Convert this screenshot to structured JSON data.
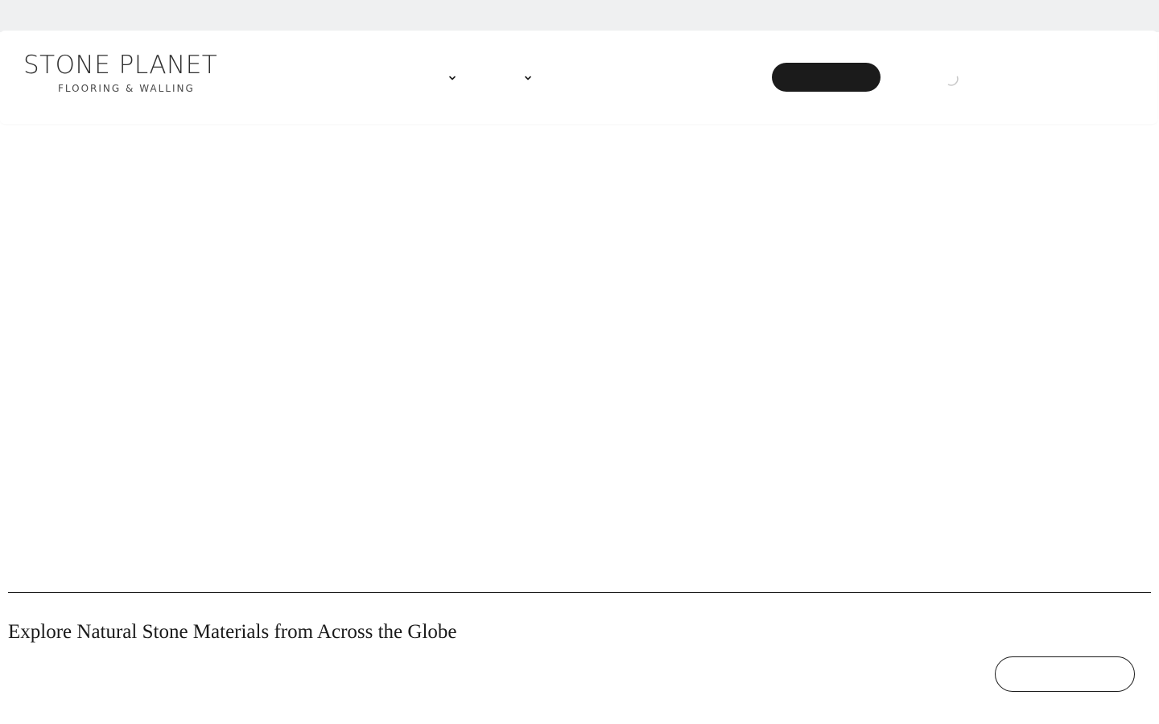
{
  "brand": {
    "name": "STONE PLANET",
    "tagline": "FLOORING & WALLING"
  },
  "nav": {
    "items": [
      {
        "label": "",
        "icon": "chevron-down-icon"
      },
      {
        "label": "",
        "icon": "chevron-down-icon"
      }
    ]
  },
  "header": {
    "cta_label": "",
    "loading_icon": "spinner-icon"
  },
  "main": {
    "headline": "Explore Natural Stone Materials from Across the Globe",
    "button_label": ""
  },
  "colors": {
    "topbar": "#eff0f1",
    "header_bg": "#ffffff",
    "cta_bg": "#1b1b1b",
    "text": "#1a1a1a"
  }
}
